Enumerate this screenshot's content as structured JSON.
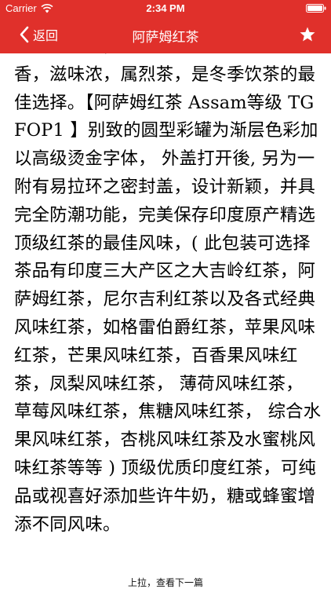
{
  "status_bar": {
    "carrier": "Carrier",
    "time": "2:34 PM"
  },
  "nav": {
    "back_label": "返回",
    "title": "阿萨姆红茶"
  },
  "article": {
    "text": "色深红稍褐，带有淡淡的麦芽香、玫瑰香，滋味浓，属烈茶，是冬季饮茶的最佳选择。【阿萨姆红茶 Assam等级 TGFOP1 】别致的圆型彩罐为渐层色彩加以高级烫金字体， 外盖打开後, 另为一附有易拉环之密封盖，设计新颖，并具完全防潮功能，完美保存印度原产精选顶级红茶的最佳风味，( 此包装可选择茶品有印度三大产区之大吉岭红茶，阿萨姆红茶，尼尔吉利红茶以及各式经典风味红茶，如格雷伯爵红茶，苹果风味红茶，芒果风味红茶，百香果风味红茶，凤梨风味红茶， 薄荷风味红茶， 草莓风味红茶，焦糖风味红茶， 综合水果风味红茶，杏桃风味红茶及水蜜桃风味红茶等等 ) 顶级优质印度红茶，可纯品或视喜好添加些许牛奶，糖或蜂蜜增添不同风味。"
  },
  "footer": {
    "hint": "上拉，查看下一篇"
  },
  "colors": {
    "nav_background": "#e0302b",
    "nav_foreground": "#ffffff",
    "body_text": "#000000"
  }
}
